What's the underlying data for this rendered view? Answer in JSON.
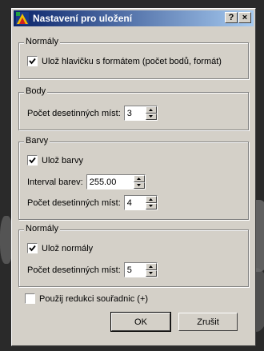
{
  "window": {
    "title": "Nastavení pro uložení",
    "help_label": "?",
    "close_label": "×"
  },
  "groups": {
    "normaly_header": {
      "legend": "Normály",
      "save_header_label": "Ulož hlavičku s formátem (počet bodů, formát)",
      "save_header_checked": true
    },
    "body": {
      "legend": "Body",
      "decimals_label": "Počet desetinných míst:",
      "decimals_value": "3"
    },
    "barvy": {
      "legend": "Barvy",
      "save_colors_label": "Ulož barvy",
      "save_colors_checked": true,
      "interval_label": "Interval barev:",
      "interval_value": "255.00",
      "decimals_label": "Počet desetinných míst:",
      "decimals_value": "4"
    },
    "normaly": {
      "legend": "Normály",
      "save_normals_label": "Ulož normály",
      "save_normals_checked": true,
      "decimals_label": "Počet desetinných míst:",
      "decimals_value": "5"
    }
  },
  "reduction": {
    "label": "Použij redukci souřadnic (+)",
    "checked": false
  },
  "buttons": {
    "ok_label": "OK",
    "cancel_label": "Zrušit"
  }
}
